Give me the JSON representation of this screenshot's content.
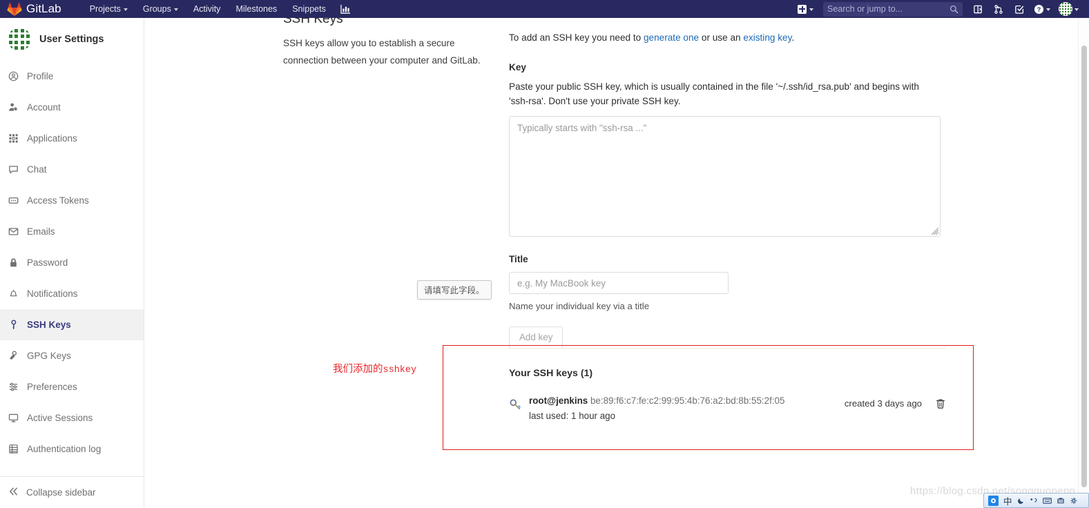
{
  "navbar": {
    "brand": "GitLab",
    "items": [
      {
        "label": "Projects",
        "has_caret": true
      },
      {
        "label": "Groups",
        "has_caret": true
      },
      {
        "label": "Activity",
        "has_caret": false
      },
      {
        "label": "Milestones",
        "has_caret": false
      },
      {
        "label": "Snippets",
        "has_caret": false
      }
    ],
    "chart_icon": "chart-icon",
    "plus_icon": "plus-icon",
    "search": {
      "placeholder": "Search or jump to...",
      "value": "",
      "icon": "search-icon"
    },
    "right_icons": [
      "issues-icon",
      "merge-requests-icon",
      "todos-icon"
    ],
    "help_icon": "help-icon",
    "avatar": "user-avatar"
  },
  "sidebar": {
    "header": {
      "title": "User Settings",
      "avatar": "user-avatar"
    },
    "items": [
      {
        "label": "Profile",
        "icon": "profile-icon",
        "active": false
      },
      {
        "label": "Account",
        "icon": "account-icon",
        "active": false
      },
      {
        "label": "Applications",
        "icon": "applications-icon",
        "active": false
      },
      {
        "label": "Chat",
        "icon": "chat-icon",
        "active": false
      },
      {
        "label": "Access Tokens",
        "icon": "access-tokens-icon",
        "active": false
      },
      {
        "label": "Emails",
        "icon": "emails-icon",
        "active": false
      },
      {
        "label": "Password",
        "icon": "password-icon",
        "active": false
      },
      {
        "label": "Notifications",
        "icon": "notifications-icon",
        "active": false
      },
      {
        "label": "SSH Keys",
        "icon": "ssh-keys-icon",
        "active": true
      },
      {
        "label": "GPG Keys",
        "icon": "gpg-keys-icon",
        "active": false
      },
      {
        "label": "Preferences",
        "icon": "preferences-icon",
        "active": false
      },
      {
        "label": "Active Sessions",
        "icon": "active-sessions-icon",
        "active": false
      },
      {
        "label": "Authentication log",
        "icon": "authentication-log-icon",
        "active": false
      }
    ],
    "collapse": {
      "label": "Collapse sidebar",
      "icon": "chevron-double-left-icon"
    }
  },
  "main": {
    "page_title": "SSH Keys",
    "left_description": "SSH keys allow you to establish a secure connection between your computer and GitLab.",
    "intro": {
      "prefix": "To add an SSH key you need to ",
      "link1": "generate one",
      "middle": " or use an ",
      "link2": "existing key",
      "suffix": "."
    },
    "key_field": {
      "label": "Key",
      "help": "Paste your public SSH key, which is usually contained in the file '~/.ssh/id_rsa.pub' and begins with 'ssh-rsa'. Don't use your private SSH key.",
      "placeholder": "Typically starts with \"ssh-rsa ...\"",
      "value": ""
    },
    "title_field": {
      "label": "Title",
      "placeholder": "e.g. My MacBook key",
      "value": "",
      "hint": "Name your individual key via a title"
    },
    "validation_tooltip": "请填写此字段。",
    "submit_label": "Add key",
    "annotation": {
      "text_cn": "我们添加的",
      "text_mono": "sshkey",
      "color": "#e8262a"
    }
  },
  "keys_panel": {
    "title": "Your SSH keys (1)",
    "rows": [
      {
        "icon": "key-icon",
        "name": "root@jenkins",
        "fingerprint": "be:89:f6:c7:fe:c2:99:95:4b:76:a2:bd:8b:55:2f:05",
        "last_used": "last used: 1 hour ago",
        "created": "created 3 days ago",
        "delete_icon": "trash-icon"
      }
    ]
  },
  "watermark": "https://blog.csdn.net/songguopeng",
  "ime": {
    "language": "中",
    "icons": [
      "ime-logo-icon",
      "moon-icon",
      "punctuation-icon",
      "keyboard-icon",
      "toolbox-icon",
      "settings-icon"
    ]
  }
}
